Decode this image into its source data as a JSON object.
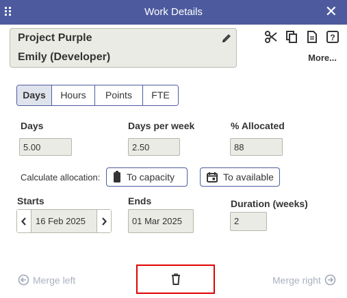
{
  "window": {
    "title": "Work Details",
    "close_icon": "close-icon",
    "drag_icon": "grip-icon"
  },
  "card": {
    "project": "Project Purple",
    "person": "Emily (Developer)",
    "edit_icon": "pencil-icon"
  },
  "toolbar": {
    "icons": [
      "scissors-icon",
      "copy-icon",
      "document-icon",
      "help-icon"
    ],
    "more_label": "More..."
  },
  "unit_tabs": {
    "items": [
      "Days",
      "Hours",
      "Points",
      "FTE"
    ],
    "active": "Days"
  },
  "fields": {
    "days": {
      "label": "Days",
      "value": "5.00"
    },
    "days_per_week": {
      "label": "Days per week",
      "value": "2.50"
    },
    "allocated": {
      "label": "% Allocated",
      "value": "88"
    }
  },
  "allocation": {
    "label": "Calculate allocation:",
    "to_capacity": "To capacity",
    "to_available": "To available"
  },
  "dates": {
    "starts_label": "Starts",
    "starts_value": "16 Feb 2025",
    "ends_label": "Ends",
    "ends_value": "01 Mar 2025",
    "duration_label": "Duration (weeks)",
    "duration_value": "2"
  },
  "footer": {
    "merge_left": "Merge left",
    "merge_right": "Merge right",
    "delete_icon": "trash-icon"
  },
  "colors": {
    "titlebar": "#4d5b9e",
    "field_bg": "#e9ebe4",
    "highlight": "#e00000",
    "disabled_text": "#aab0bd"
  }
}
